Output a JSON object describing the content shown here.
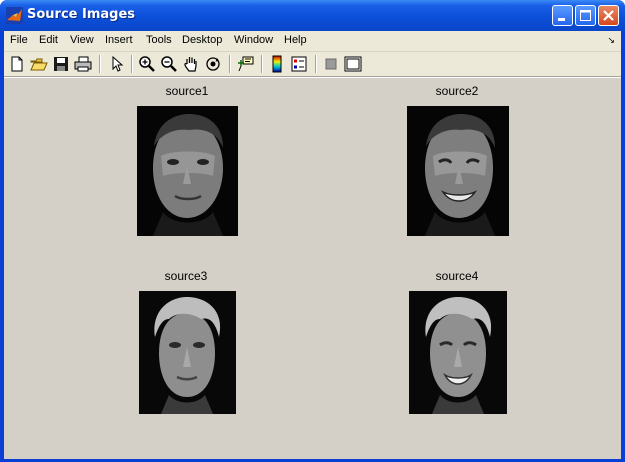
{
  "window": {
    "title": "Source Images"
  },
  "menu": [
    "File",
    "Edit",
    "View",
    "Insert",
    "Tools",
    "Desktop",
    "Window",
    "Help"
  ],
  "toolbar": [
    "new-figure",
    "open-file",
    "save-figure",
    "print-figure",
    "edit-plot",
    "zoom-in",
    "zoom-out",
    "pan",
    "rotate-3d",
    "data-cursor",
    "insert-colorbar",
    "insert-legend",
    "hide-plot-tools",
    "show-plot-tools"
  ],
  "axes": [
    {
      "title": "source1",
      "subject": "man with short dark hair, neutral expression"
    },
    {
      "title": "source2",
      "subject": "man with short dark hair, smiling"
    },
    {
      "title": "source3",
      "subject": "man with grey wavy hair, neutral expression"
    },
    {
      "title": "source4",
      "subject": "man with grey wavy hair, smiling"
    }
  ]
}
